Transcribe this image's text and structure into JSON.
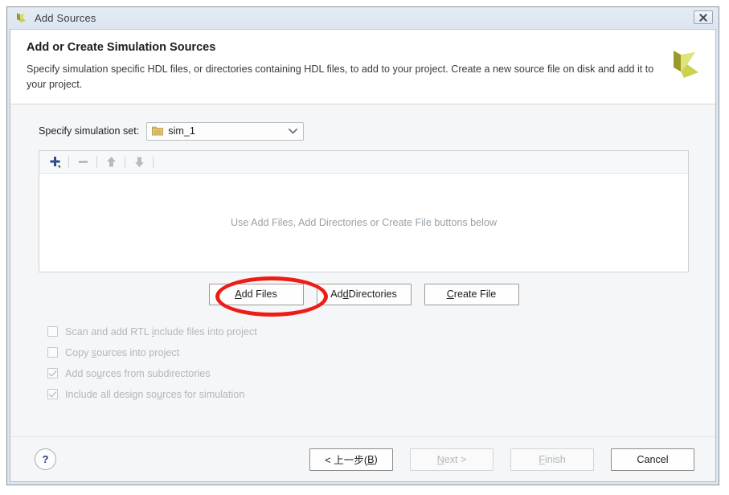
{
  "window": {
    "title": "Add Sources",
    "title_icon": "vivado-logo-icon",
    "close_label": "✖"
  },
  "header": {
    "title": "Add or Create Simulation Sources",
    "description": "Specify simulation specific HDL files, or directories containing HDL files, to add to your project. Create a new source file on disk and add it to your project.",
    "logo_icon": "xilinx-logo-icon"
  },
  "simulation_set": {
    "label": "Specify simulation set:",
    "value": "sim_1",
    "icon": "folder-icon",
    "chevron_icon": "chevron-down-icon"
  },
  "file_list": {
    "empty_text": "Use Add Files, Add Directories or Create File buttons below",
    "toolbar": [
      {
        "name": "add-button",
        "icon": "plus-icon",
        "enabled": true
      },
      {
        "name": "remove-button",
        "icon": "minus-icon",
        "enabled": false
      },
      {
        "name": "move-up-button",
        "icon": "arrow-up-icon",
        "enabled": false
      },
      {
        "name": "move-down-button",
        "icon": "arrow-down-icon",
        "enabled": false
      }
    ]
  },
  "action_buttons": [
    {
      "name": "add-files-button",
      "pre": "A",
      "mnemonic": "",
      "label_before": "",
      "label": "Add Files",
      "mnemonic_index": 0
    },
    {
      "name": "add-directories-button",
      "label": "Add Directories",
      "mnemonic_index": 2
    },
    {
      "name": "create-file-button",
      "label": "Create File",
      "mnemonic_index": 0
    }
  ],
  "annotation": {
    "shape": "ellipse",
    "color": "#ee1c16",
    "target": "Add Files"
  },
  "options": [
    {
      "name": "scan-rtl-include-checkbox",
      "label": "Scan and add RTL include files into project",
      "checked": false,
      "enabled": false,
      "mnemonic_index": 17
    },
    {
      "name": "copy-sources-checkbox",
      "label": "Copy sources into project",
      "checked": false,
      "enabled": false,
      "mnemonic_index": 5
    },
    {
      "name": "add-subdirectories-checkbox",
      "label": "Add sources from subdirectories",
      "checked": true,
      "enabled": false,
      "mnemonic_index": 6
    },
    {
      "name": "include-design-sources-checkbox",
      "label": "Include all design sources for simulation",
      "checked": true,
      "enabled": false,
      "mnemonic_index": 21
    }
  ],
  "footer": {
    "help_label": "?",
    "buttons": [
      {
        "name": "back-button",
        "label": "< 上一步(B)",
        "enabled": true,
        "mnemonic": "B"
      },
      {
        "name": "next-button",
        "label": "Next >",
        "enabled": false,
        "mnemonic_index": 0
      },
      {
        "name": "finish-button",
        "label": "Finish",
        "enabled": false,
        "mnemonic_index": 0
      },
      {
        "name": "cancel-button",
        "label": "Cancel",
        "enabled": true
      }
    ]
  }
}
